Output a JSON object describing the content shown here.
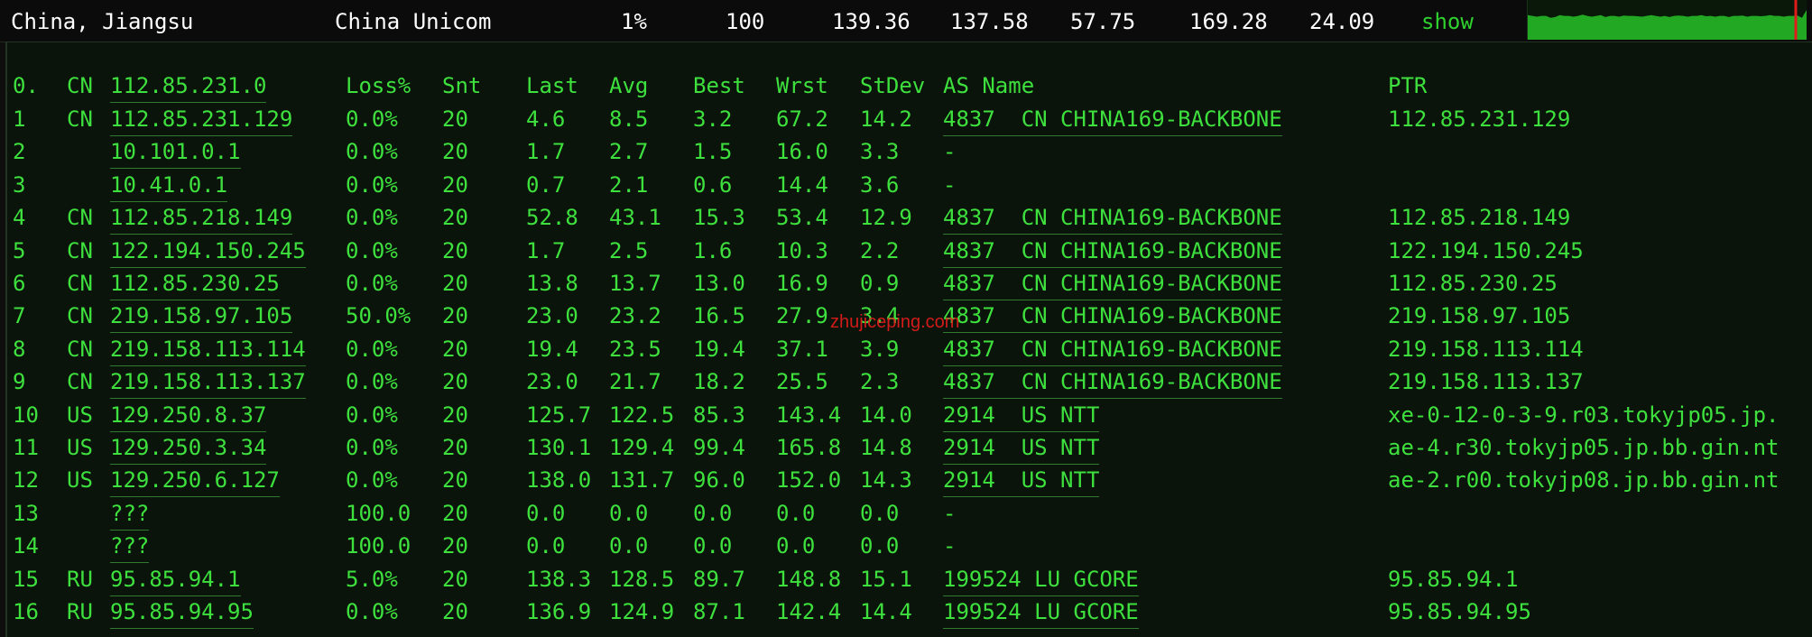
{
  "header": {
    "location": "China, Jiangsu",
    "isp": "China Unicom",
    "loss": "1%",
    "sent": "100",
    "last": "139.36",
    "avg": "137.58",
    "best": "57.75",
    "worst": "169.28",
    "stdev": "24.09",
    "show_label": "show"
  },
  "columns": {
    "hop": "0.",
    "cc": "CN",
    "host": "112.85.231.0",
    "loss": "Loss%",
    "snt": "Snt",
    "last": "Last",
    "avg": "Avg",
    "best": "Best",
    "wrst": "Wrst",
    "stdev": "StDev",
    "as_name": "AS Name",
    "ptr": "PTR"
  },
  "hops": [
    {
      "hop": "1",
      "cc": "CN",
      "host": "112.85.231.129",
      "loss": "0.0%",
      "snt": "20",
      "last": "4.6",
      "avg": "8.5",
      "best": "3.2",
      "wrst": "67.2",
      "stdev": "14.2",
      "as": "4837  CN CHINA169-BACKBONE",
      "ptr": "112.85.231.129"
    },
    {
      "hop": "2",
      "cc": "",
      "host": "10.101.0.1",
      "loss": "0.0%",
      "snt": "20",
      "last": "1.7",
      "avg": "2.7",
      "best": "1.5",
      "wrst": "16.0",
      "stdev": "3.3",
      "as": "-",
      "ptr": ""
    },
    {
      "hop": "3",
      "cc": "",
      "host": "10.41.0.1",
      "loss": "0.0%",
      "snt": "20",
      "last": "0.7",
      "avg": "2.1",
      "best": "0.6",
      "wrst": "14.4",
      "stdev": "3.6",
      "as": "-",
      "ptr": ""
    },
    {
      "hop": "4",
      "cc": "CN",
      "host": "112.85.218.149",
      "loss": "0.0%",
      "snt": "20",
      "last": "52.8",
      "avg": "43.1",
      "best": "15.3",
      "wrst": "53.4",
      "stdev": "12.9",
      "as": "4837  CN CHINA169-BACKBONE",
      "ptr": "112.85.218.149"
    },
    {
      "hop": "5",
      "cc": "CN",
      "host": "122.194.150.245",
      "loss": "0.0%",
      "snt": "20",
      "last": "1.7",
      "avg": "2.5",
      "best": "1.6",
      "wrst": "10.3",
      "stdev": "2.2",
      "as": "4837  CN CHINA169-BACKBONE",
      "ptr": "122.194.150.245"
    },
    {
      "hop": "6",
      "cc": "CN",
      "host": "112.85.230.25",
      "loss": "0.0%",
      "snt": "20",
      "last": "13.8",
      "avg": "13.7",
      "best": "13.0",
      "wrst": "16.9",
      "stdev": "0.9",
      "as": "4837  CN CHINA169-BACKBONE",
      "ptr": "112.85.230.25"
    },
    {
      "hop": "7",
      "cc": "CN",
      "host": "219.158.97.105",
      "loss": "50.0%",
      "snt": "20",
      "last": "23.0",
      "avg": "23.2",
      "best": "16.5",
      "wrst": "27.9",
      "stdev": "3.4",
      "as": "4837  CN CHINA169-BACKBONE",
      "ptr": "219.158.97.105"
    },
    {
      "hop": "8",
      "cc": "CN",
      "host": "219.158.113.114",
      "loss": "0.0%",
      "snt": "20",
      "last": "19.4",
      "avg": "23.5",
      "best": "19.4",
      "wrst": "37.1",
      "stdev": "3.9",
      "as": "4837  CN CHINA169-BACKBONE",
      "ptr": "219.158.113.114"
    },
    {
      "hop": "9",
      "cc": "CN",
      "host": "219.158.113.137",
      "loss": "0.0%",
      "snt": "20",
      "last": "23.0",
      "avg": "21.7",
      "best": "18.2",
      "wrst": "25.5",
      "stdev": "2.3",
      "as": "4837  CN CHINA169-BACKBONE",
      "ptr": "219.158.113.137"
    },
    {
      "hop": "10",
      "cc": "US",
      "host": "129.250.8.37",
      "loss": "0.0%",
      "snt": "20",
      "last": "125.7",
      "avg": "122.5",
      "best": "85.3",
      "wrst": "143.4",
      "stdev": "14.0",
      "as": "2914  US NTT",
      "ptr": "xe-0-12-0-3-9.r03.tokyjp05.jp."
    },
    {
      "hop": "11",
      "cc": "US",
      "host": "129.250.3.34",
      "loss": "0.0%",
      "snt": "20",
      "last": "130.1",
      "avg": "129.4",
      "best": "99.4",
      "wrst": "165.8",
      "stdev": "14.8",
      "as": "2914  US NTT",
      "ptr": "ae-4.r30.tokyjp05.jp.bb.gin.nt"
    },
    {
      "hop": "12",
      "cc": "US",
      "host": "129.250.6.127",
      "loss": "0.0%",
      "snt": "20",
      "last": "138.0",
      "avg": "131.7",
      "best": "96.0",
      "wrst": "152.0",
      "stdev": "14.3",
      "as": "2914  US NTT",
      "ptr": "ae-2.r00.tokyjp08.jp.bb.gin.nt"
    },
    {
      "hop": "13",
      "cc": "",
      "host": "???",
      "loss": "100.0",
      "snt": "20",
      "last": "0.0",
      "avg": "0.0",
      "best": "0.0",
      "wrst": "0.0",
      "stdev": "0.0",
      "as": "-",
      "ptr": ""
    },
    {
      "hop": "14",
      "cc": "",
      "host": "???",
      "loss": "100.0",
      "snt": "20",
      "last": "0.0",
      "avg": "0.0",
      "best": "0.0",
      "wrst": "0.0",
      "stdev": "0.0",
      "as": "-",
      "ptr": ""
    },
    {
      "hop": "15",
      "cc": "RU",
      "host": "95.85.94.1",
      "loss": "5.0%",
      "snt": "20",
      "last": "138.3",
      "avg": "128.5",
      "best": "89.7",
      "wrst": "148.8",
      "stdev": "15.1",
      "as": "199524 LU GCORE",
      "ptr": "95.85.94.1"
    },
    {
      "hop": "16",
      "cc": "RU",
      "host": "95.85.94.95",
      "loss": "0.0%",
      "snt": "20",
      "last": "136.9",
      "avg": "124.9",
      "best": "87.1",
      "wrst": "142.4",
      "stdev": "14.4",
      "as": "199524 LU GCORE",
      "ptr": "95.85.94.95"
    }
  ],
  "watermark": "zhujiceping.com",
  "sparkline": {
    "fill_color": "#22a822",
    "marker_color": "#e01c1c",
    "levels": [
      0.62,
      0.6,
      0.58,
      0.6,
      0.6,
      0.55,
      0.57,
      0.62,
      0.6,
      0.6,
      0.58,
      0.6,
      0.63,
      0.6,
      0.58,
      0.6,
      0.62,
      0.57,
      0.6,
      0.6,
      0.58,
      0.61,
      0.6,
      0.6,
      0.59,
      0.58,
      0.6,
      0.62,
      0.6,
      0.58,
      0.6,
      0.57,
      0.6,
      0.61,
      0.6,
      0.58,
      0.6,
      0.6,
      0.62,
      0.59,
      0.6,
      0.58,
      0.6,
      0.6,
      0.57,
      0.6,
      0.6,
      0.61,
      0.58,
      0.6,
      0.6,
      0.59,
      0.6,
      0.62,
      0.6,
      0.6,
      0.58,
      0.6,
      0.6,
      0.61,
      0.55,
      0.75
    ]
  },
  "colors": {
    "text_green": "#3ee03e",
    "header_text": "#ffffff",
    "background": "#0a140a"
  }
}
